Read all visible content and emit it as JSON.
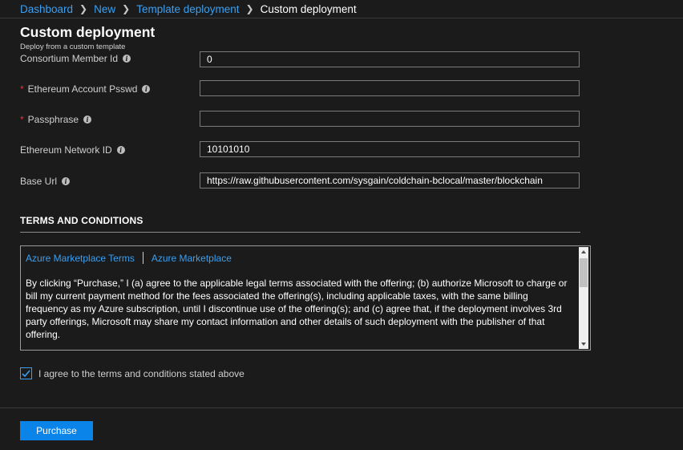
{
  "breadcrumb": {
    "items": [
      "Dashboard",
      "New",
      "Template deployment"
    ],
    "current": "Custom deployment"
  },
  "header": {
    "title": "Custom deployment",
    "subtitle": "Deploy from a custom template"
  },
  "fields": [
    {
      "label": "Consortium Member Id",
      "required": false,
      "value": "0"
    },
    {
      "label": "Ethereum Account Psswd",
      "required": true,
      "value": ""
    },
    {
      "label": "Passphrase",
      "required": true,
      "value": ""
    },
    {
      "label": "Ethereum Network ID",
      "required": false,
      "value": "10101010"
    },
    {
      "label": "Base Url",
      "required": false,
      "value": "https://raw.githubusercontent.com/sysgain/coldchain-bclocal/master/blockchain"
    }
  ],
  "required_marker": "*",
  "terms": {
    "heading": "TERMS AND CONDITIONS",
    "tabs": [
      "Azure Marketplace Terms",
      "Azure Marketplace"
    ],
    "text": "By clicking “Purchase,” I (a) agree to the applicable legal terms associated with the offering; (b) authorize Microsoft to charge or bill my current payment method for the fees associated the offering(s), including applicable taxes, with the same billing frequency as my Azure subscription, until I discontinue use of the offering(s); and (c) agree that, if the deployment involves 3rd party offerings, Microsoft may share my contact information and other details of such deployment with the publisher of that offering."
  },
  "agree": {
    "label": "I agree to the terms and conditions stated above",
    "checked": true
  },
  "actions": {
    "purchase_label": "Purchase"
  },
  "colors": {
    "accent": "#0a84e8",
    "link": "#3aa0f3",
    "required": "#e0363d",
    "background": "#1b1b1b"
  }
}
